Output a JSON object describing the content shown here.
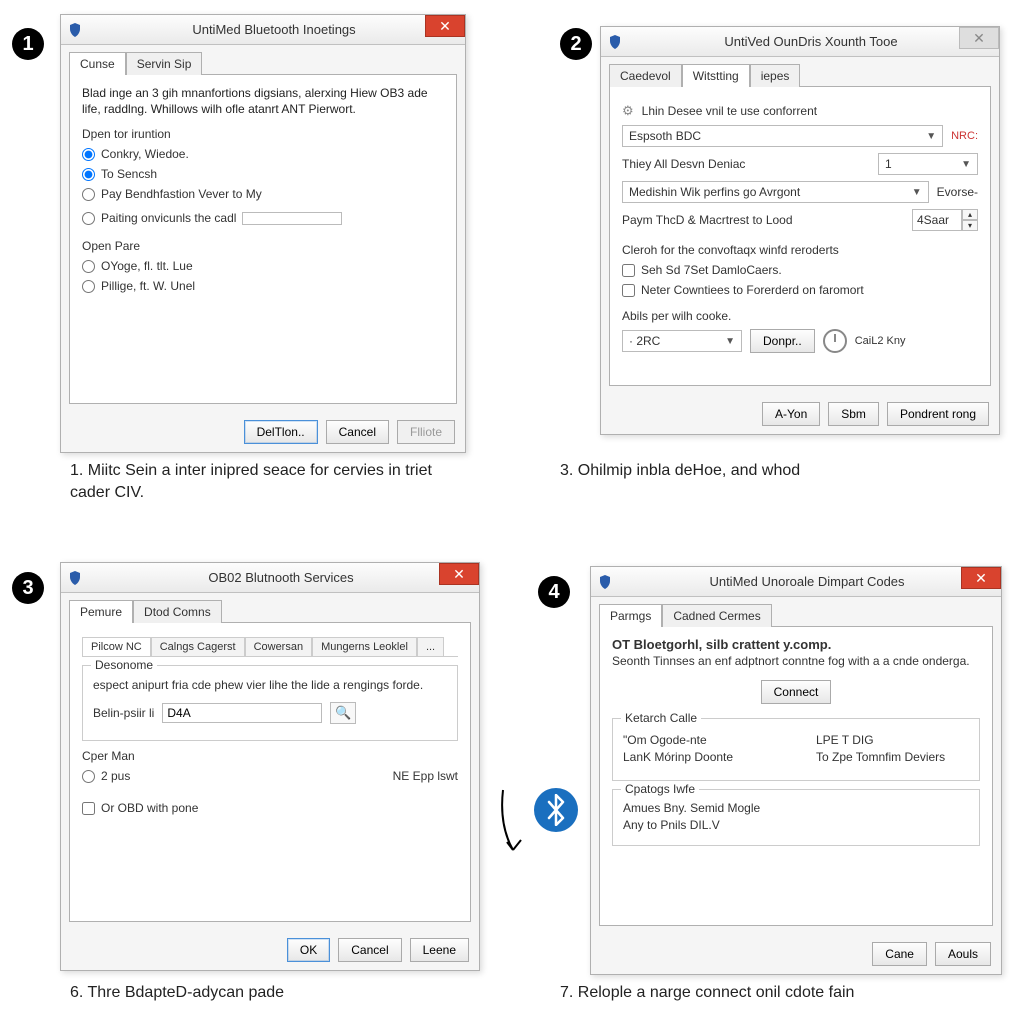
{
  "steps": {
    "s1": {
      "num": "1",
      "caption": "1.  Miitc Sein a inter inipred seace for cervies in triet cader CIV."
    },
    "s2": {
      "num": "2",
      "caption": "3.  Ohilmip inbla deHoe, and whod"
    },
    "s3": {
      "num": "3",
      "caption": "6.  Thre BdapteD-adycan pade"
    },
    "s4": {
      "num": "4",
      "caption": "7.  Relople a narge connect onil cdote fain"
    }
  },
  "dlg1": {
    "title": "UntiMed Bluetooth Inoetings",
    "tabs": {
      "t1": "Cunse",
      "t2": "Servin Sip"
    },
    "intro": "Blad inge an 3 gih mnanfortions digsians, alerxing Hiew OB3 ade life, raddlng. Whillows wilh ofle atanrt ANT Pierwort.",
    "sec1": "Dpen tor iruntion",
    "r1": "Conkry, Wiedoe.",
    "r2": "To Sencsh",
    "r3": "Pay Bendhfastion Vever to My",
    "r4": "Paiting onvicunls the cadl",
    "sec2": "Open Pare",
    "r5": "OYoge, fl. tlt. Lue",
    "r6": "Pillige, ft. W. Unel",
    "btn1": "DelTlon..",
    "btn2": "Cancel",
    "btn3": "Flliote"
  },
  "dlg2": {
    "title": "UntiVed OunDris Xounth Tooe",
    "tabs": {
      "t1": "Caedevol",
      "t2": "Witstting",
      "t3": "iepes"
    },
    "top_label": "Lhin Desee vnil te use conforrent",
    "dd1_val": "Espsoth BDC",
    "dd1_side": "NRC:",
    "row2_label": "Thiey All Desvn Deniac",
    "row2_val": "1",
    "dd3_val": "Medishin Wik perfins go Avrgont",
    "dd3_side": "Evorse-",
    "row4_label": "Paym ThcD & Macrtrest to Lood",
    "row4_val": "4Saar",
    "sec_checks": "Cleroh for the convoftaqx winfd reroderts",
    "chk1": "Seh Sd 7Set DamloCaers.",
    "chk2": "Neter Cowntiees to Forerderd on faromort",
    "sec_bottom": "Abils per wilh cooke.",
    "dd_bottom": "· 2RC",
    "btn_donpr": "Donpr..",
    "after_label": "CaiL2\nKny",
    "btn_b1": "A-Yon",
    "btn_b2": "Sbm",
    "btn_b3": "Pondrent rong"
  },
  "dlg3": {
    "title": "OB02 Blutnooth Services",
    "tabs": {
      "t1": "Pemure",
      "t2": "Dtod Comns"
    },
    "subtabs": {
      "s1": "Pilcow NC",
      "s2": "Calngs Cagerst",
      "s3": "Cowersan",
      "s4": "Mungerns Leoklel",
      "s5": "..."
    },
    "group_title": "Desonome",
    "group_text": "espect anipurt fria cde phew vier lihe the lide a rengings forde.",
    "pair_label": "Belin-psiir li",
    "pair_val": "D4A",
    "sec_open": "Cper Man",
    "radio_open": "2 pus",
    "right_text": "NE Epp lswt",
    "chk_bottom": "Or OBD with pone",
    "btn1": "OK",
    "btn2": "Cancel",
    "btn3": "Leene"
  },
  "dlg4": {
    "title": "UntiMed Unoroale Dimpart Codes",
    "tabs": {
      "t1": "Parmgs",
      "t2": "Cadned Cermes"
    },
    "head1": "OT Bloetgorhl, silb crattent y.comp.",
    "head2": "Seonth Tinnses an enf adptnort conntne fog with a a cnde onderga.",
    "btn_connect": "Connect",
    "group1_title": "Ketarch Calle",
    "g1_l1": "\"Om Ogode-nte",
    "g1_l2": "LanK Mórinp Doonte",
    "g1_r1": "LPE T DIG",
    "g1_r2": "To Zpe Tomnfim Deviers",
    "group2_title": "Cpatogs Iwfe",
    "g2_l1": "Amues Bny. Semid Mogle",
    "g2_l2": "Any to Pnils DIL.V",
    "btn_b1": "Cane",
    "btn_b2": "Aouls"
  }
}
